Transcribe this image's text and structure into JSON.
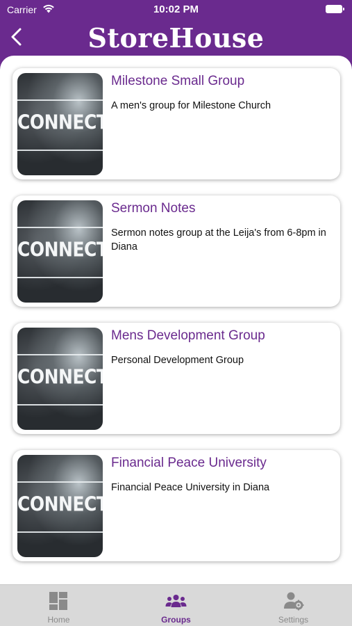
{
  "status_bar": {
    "carrier": "Carrier",
    "time": "10:02 PM"
  },
  "header": {
    "logo_text": "StoreHouse",
    "back_icon": "chevron-left-icon"
  },
  "colors": {
    "brand": "#6a2a8e",
    "tab_inactive": "#8a8a8a",
    "tab_bar_bg": "#d9d9d9"
  },
  "groups": [
    {
      "thumbnail_text": "CONNECT",
      "title": "Milestone Small Group",
      "description": "A men's group for Milestone Church"
    },
    {
      "thumbnail_text": "CONNECT",
      "title": "Sermon Notes",
      "description": "Sermon notes group at the Leija's from 6-8pm in Diana"
    },
    {
      "thumbnail_text": "CONNECT",
      "title": "Mens Development Group",
      "description": "Personal Development Group"
    },
    {
      "thumbnail_text": "CONNECT",
      "title": "Financial Peace University",
      "description": "Financial Peace University in Diana"
    }
  ],
  "tabs": [
    {
      "label": "Home",
      "icon": "dashboard-grid-icon",
      "active": false
    },
    {
      "label": "Groups",
      "icon": "people-group-icon",
      "active": true
    },
    {
      "label": "Settings",
      "icon": "user-gear-icon",
      "active": false
    }
  ]
}
